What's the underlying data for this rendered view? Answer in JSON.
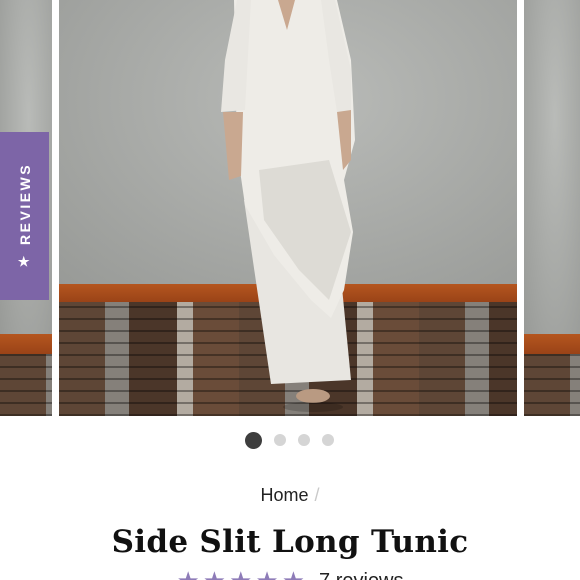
{
  "gallery": {
    "slide_count": 4,
    "active_slide": 1,
    "image_alt": "Woman wearing a white linen side slit long tunic over wide pants, standing barefoot on a wooden floor"
  },
  "reviews_tab": {
    "label": "REVIEWS",
    "icon": "star-icon",
    "color": "#7d65a7"
  },
  "breadcrumb": {
    "home": "Home",
    "separator": "/"
  },
  "product": {
    "title": "Side Slit Long Tunic",
    "rating": {
      "stars": 5,
      "count_label": "7 reviews",
      "star_color": "#8e7cb8"
    }
  }
}
